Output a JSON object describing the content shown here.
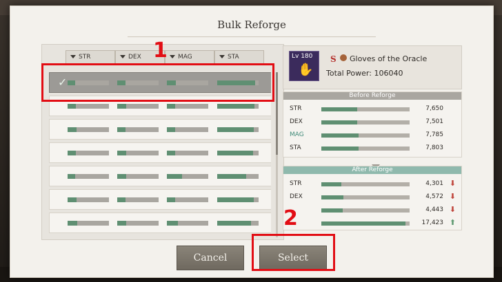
{
  "dialog": {
    "title": "Bulk Reforge"
  },
  "filters": [
    "STR",
    "DEX",
    "MAG",
    "STA"
  ],
  "rows": [
    {
      "selected": true,
      "fills": [
        0.18,
        0.2,
        0.22,
        0.92
      ]
    },
    {
      "selected": false,
      "fills": [
        0.2,
        0.22,
        0.2,
        0.9
      ]
    },
    {
      "selected": false,
      "fills": [
        0.22,
        0.2,
        0.2,
        0.88
      ]
    },
    {
      "selected": false,
      "fills": [
        0.2,
        0.22,
        0.2,
        0.86
      ]
    },
    {
      "selected": false,
      "fills": [
        0.18,
        0.22,
        0.36,
        0.7
      ]
    },
    {
      "selected": false,
      "fills": [
        0.22,
        0.2,
        0.2,
        0.88
      ]
    },
    {
      "selected": false,
      "fills": [
        0.24,
        0.22,
        0.26,
        0.82
      ]
    }
  ],
  "item": {
    "level": "Lv 180",
    "rank": "S",
    "name": "Gloves of the Oracle",
    "total_power": "Total Power: 106040"
  },
  "before": {
    "heading": "Before Reforge",
    "stats": [
      {
        "label": "STR",
        "value": "7,650",
        "fill": 0.41,
        "highlight": false
      },
      {
        "label": "DEX",
        "value": "7,501",
        "fill": 0.41,
        "highlight": false
      },
      {
        "label": "MAG",
        "value": "7,785",
        "fill": 0.42,
        "highlight": true
      },
      {
        "label": "STA",
        "value": "7,803",
        "fill": 0.42,
        "highlight": false
      }
    ]
  },
  "after": {
    "heading": "After Reforge",
    "stats": [
      {
        "label": "STR",
        "value": "4,301",
        "fill": 0.23,
        "change": "down"
      },
      {
        "label": "DEX",
        "value": "4,572",
        "fill": 0.25,
        "change": "down"
      },
      {
        "label": "",
        "value": "4,443",
        "fill": 0.24,
        "change": "down"
      },
      {
        "label": "",
        "value": "17,423",
        "fill": 0.95,
        "change": "up"
      }
    ]
  },
  "buttons": {
    "cancel": "Cancel",
    "select": "Select"
  },
  "callouts": [
    "1",
    "2"
  ],
  "colors": {
    "accent_green": "#5f8f72",
    "callout_red": "#e20d14",
    "stat_down": "#c0463d",
    "stat_up": "#5f9a72"
  }
}
